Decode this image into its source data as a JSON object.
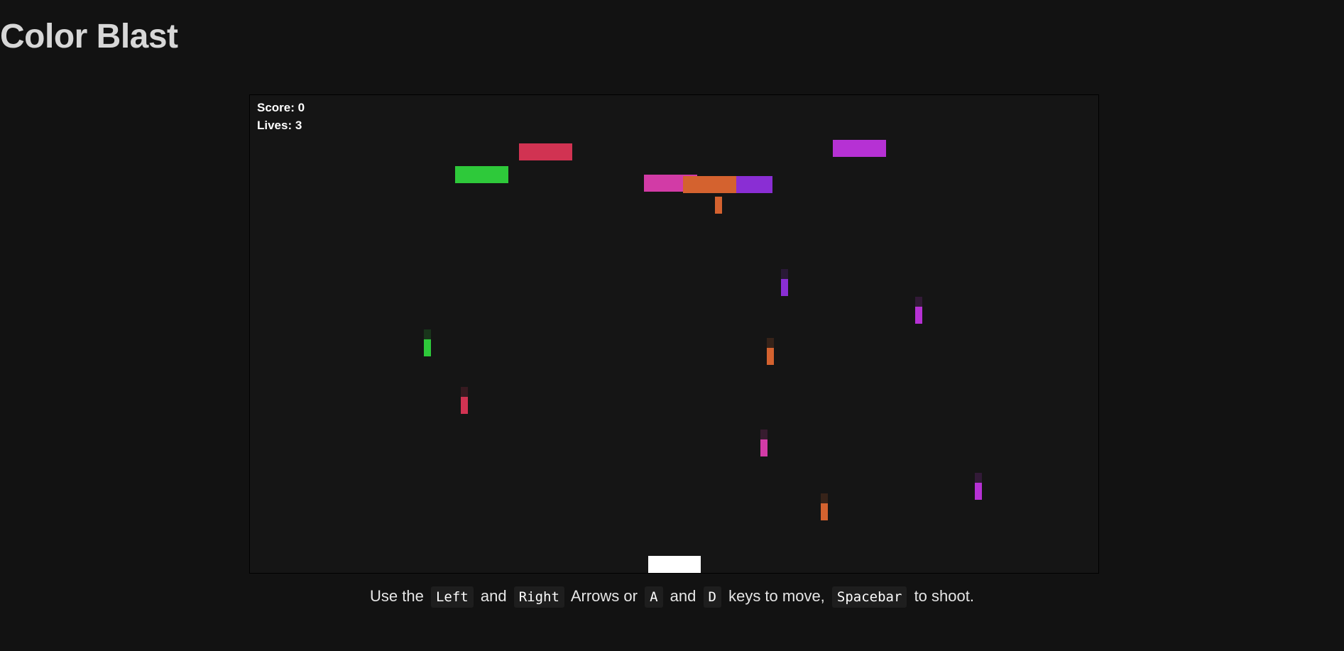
{
  "page": {
    "title": "Color Blast"
  },
  "hud": {
    "score": "Score: 0",
    "lives": "Lives: 3"
  },
  "colors": {
    "background": "#121212",
    "canvas": "#151515",
    "player": "#ffffff",
    "green": "#2ec93a",
    "red": "#d13352",
    "pink": "#d23ba6",
    "orange": "#d4622f",
    "purple": "#8a2ed4",
    "magenta": "#b631d4"
  },
  "instructions": {
    "t1": "Use the",
    "k1": "Left",
    "t2": "and",
    "k2": "Right",
    "t3": "Arrows or",
    "k3": "A",
    "t4": "and",
    "k4": "D",
    "t5": "keys to move,",
    "k5": "Spacebar",
    "t6": "to shoot."
  }
}
